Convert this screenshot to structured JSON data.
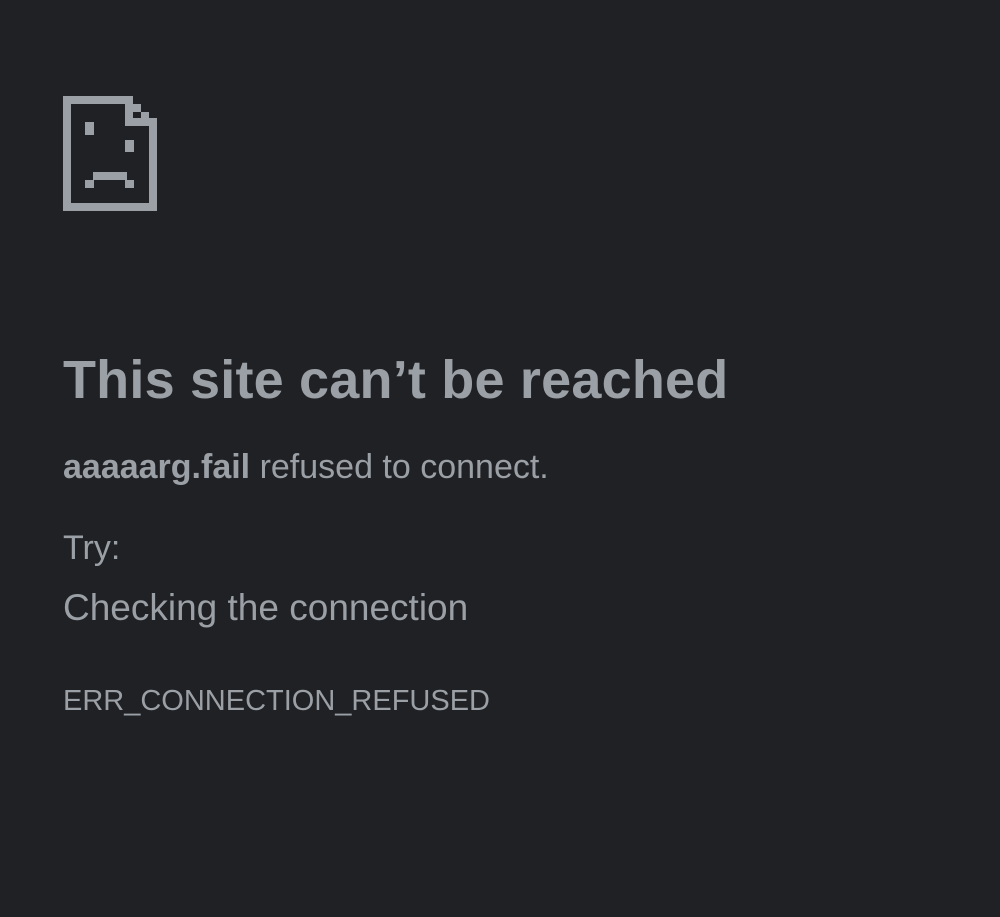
{
  "colors": {
    "background": "#202124",
    "text": "#9aa0a6"
  },
  "icon": "sad-page-icon",
  "title": "This site can’t be reached",
  "summary": {
    "host": "aaaaarg.fail",
    "message": " refused to connect."
  },
  "try_label": "Try:",
  "suggestions": [
    "Checking the connection"
  ],
  "error_code": "ERR_CONNECTION_REFUSED"
}
